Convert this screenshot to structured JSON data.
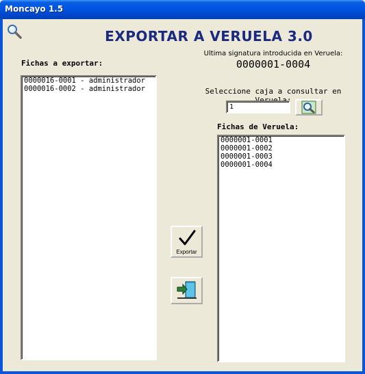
{
  "window": {
    "title": "Moncayo 1.5"
  },
  "header": {
    "title": "EXPORTAR A VERUELA 3.0"
  },
  "left_panel": {
    "label": "Fichas a exportar:",
    "items": [
      "0000016-0001 - administrador",
      "0000016-0002 - administrador"
    ]
  },
  "last_signature": {
    "label": "Ultima signatura introducida en Veruela:",
    "value": "0000001-0004"
  },
  "box_select": {
    "label": "Seleccione caja a consultar en Veruela:",
    "value": "1"
  },
  "right_panel": {
    "label": "Fichas de Veruela:",
    "items": [
      "0000001-0001",
      "0000001-0002",
      "0000001-0003",
      "0000001-0004"
    ]
  },
  "actions": {
    "export_label": "Exportar"
  },
  "icons": {
    "search": "magnifier-icon",
    "export": "checkmark-icon",
    "exit": "exit-door-icon"
  },
  "colors": {
    "title_blue": "#1b2a7e",
    "titlebar": "#0054e3",
    "background": "#ece9d8"
  }
}
